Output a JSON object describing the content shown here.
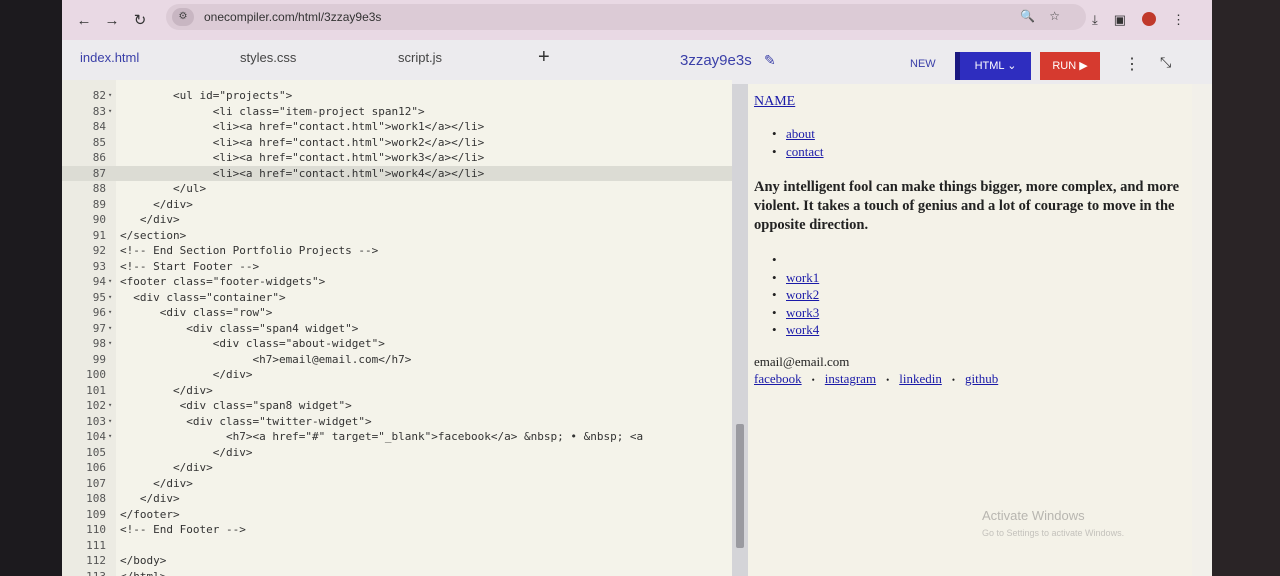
{
  "browser": {
    "url": "onecompiler.com/html/3zzay9e3s",
    "back_icon": "arrow-left-icon",
    "forward_icon": "arrow-right-icon",
    "reload_icon": "reload-icon"
  },
  "app": {
    "tabs": [
      {
        "label": "index.html",
        "active": true
      },
      {
        "label": "styles.css",
        "active": false
      },
      {
        "label": "script.js",
        "active": false
      }
    ],
    "add_tab": "+",
    "project_name": "3zzay9e3s",
    "new_label": "NEW",
    "language_label": "HTML",
    "run_label": "RUN",
    "accent": "#2e2dbf",
    "run_color": "#d63a2f"
  },
  "editor": {
    "lines": [
      {
        "n": "82",
        "fold": true,
        "code": "        <ul id=\"projects\">"
      },
      {
        "n": "83",
        "fold": true,
        "code": "              <li class=\"item-project span12\">"
      },
      {
        "n": "84",
        "fold": false,
        "code": "              <li><a href=\"contact.html\">work1</a></li>"
      },
      {
        "n": "85",
        "fold": false,
        "code": "              <li><a href=\"contact.html\">work2</a></li>"
      },
      {
        "n": "86",
        "fold": false,
        "code": "              <li><a href=\"contact.html\">work3</a></li>"
      },
      {
        "n": "87",
        "fold": false,
        "code": "              <li><a href=\"contact.html\">work4</a></li>"
      },
      {
        "n": "88",
        "fold": false,
        "code": "        </ul>"
      },
      {
        "n": "89",
        "fold": false,
        "code": "     </div>"
      },
      {
        "n": "90",
        "fold": false,
        "code": "   </div>"
      },
      {
        "n": "91",
        "fold": false,
        "code": "</section>"
      },
      {
        "n": "92",
        "fold": false,
        "code": "<!-- End Section Portfolio Projects -->"
      },
      {
        "n": "93",
        "fold": false,
        "code": "<!-- Start Footer -->"
      },
      {
        "n": "94",
        "fold": true,
        "code": "<footer class=\"footer-widgets\">"
      },
      {
        "n": "95",
        "fold": true,
        "code": "  <div class=\"container\">"
      },
      {
        "n": "96",
        "fold": true,
        "code": "      <div class=\"row\">"
      },
      {
        "n": "97",
        "fold": true,
        "code": "          <div class=\"span4 widget\">"
      },
      {
        "n": "98",
        "fold": true,
        "code": "              <div class=\"about-widget\">"
      },
      {
        "n": "99",
        "fold": false,
        "code": "                    <h7>email@email.com</h7>"
      },
      {
        "n": "100",
        "fold": false,
        "code": "              </div>"
      },
      {
        "n": "101",
        "fold": false,
        "code": "        </div>"
      },
      {
        "n": "102",
        "fold": true,
        "code": "         <div class=\"span8 widget\">"
      },
      {
        "n": "103",
        "fold": true,
        "code": "          <div class=\"twitter-widget\">"
      },
      {
        "n": "104",
        "fold": true,
        "code": "                <h7><a href=\"#\" target=\"_blank\">facebook</a> &nbsp; • &nbsp; <a"
      },
      {
        "n": "105",
        "fold": false,
        "code": "              </div>"
      },
      {
        "n": "106",
        "fold": false,
        "code": "        </div>"
      },
      {
        "n": "107",
        "fold": false,
        "code": "     </div>"
      },
      {
        "n": "108",
        "fold": false,
        "code": "   </div>"
      },
      {
        "n": "109",
        "fold": false,
        "code": "</footer>"
      },
      {
        "n": "110",
        "fold": false,
        "code": "<!-- End Footer -->"
      },
      {
        "n": "111",
        "fold": false,
        "code": ""
      },
      {
        "n": "112",
        "fold": false,
        "code": "</body>"
      },
      {
        "n": "113",
        "fold": false,
        "code": "</html>"
      }
    ],
    "highlighted_line": "87"
  },
  "preview": {
    "name": "NAME",
    "nav": [
      "about",
      "contact"
    ],
    "quote": "Any intelligent fool can make things bigger, more complex, and more violent. It takes a touch of genius and a lot of courage to move in the opposite direction.",
    "works": [
      "",
      "work1",
      "work2",
      "work3",
      "work4"
    ],
    "email": "email@email.com",
    "social": [
      "facebook",
      "instagram",
      "linkedin",
      "github"
    ],
    "social_sep": "•",
    "bullet": "•"
  },
  "watermark": {
    "title": "Activate Windows",
    "subtitle": "Go to Settings to activate Windows."
  }
}
